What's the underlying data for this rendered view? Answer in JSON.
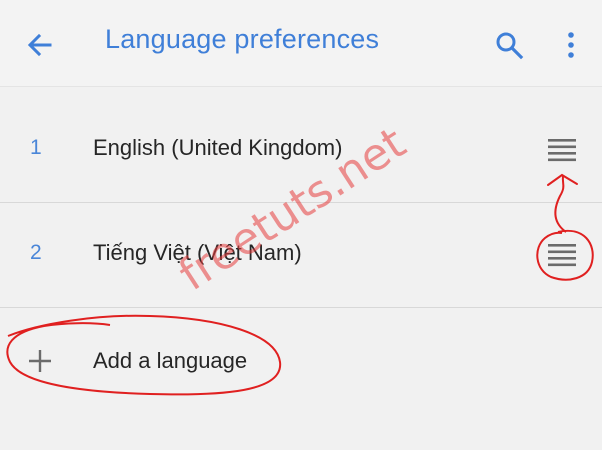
{
  "header": {
    "back_icon": "arrow-back-icon",
    "title": "Language preferences",
    "search_icon": "search-icon",
    "more_icon": "more-vertical-icon",
    "accent_color": "#3f7fd8"
  },
  "languages": [
    {
      "index": "1",
      "label": "English (United Kingdom)",
      "handle_icon": "drag-handle-icon"
    },
    {
      "index": "2",
      "label": "Tiếng Việt (Việt Nam)",
      "handle_icon": "drag-handle-icon"
    }
  ],
  "add_language": {
    "icon": "plus-icon",
    "label": "Add a language"
  },
  "watermark": "freetuts.net",
  "annotation_color": "#e02020"
}
